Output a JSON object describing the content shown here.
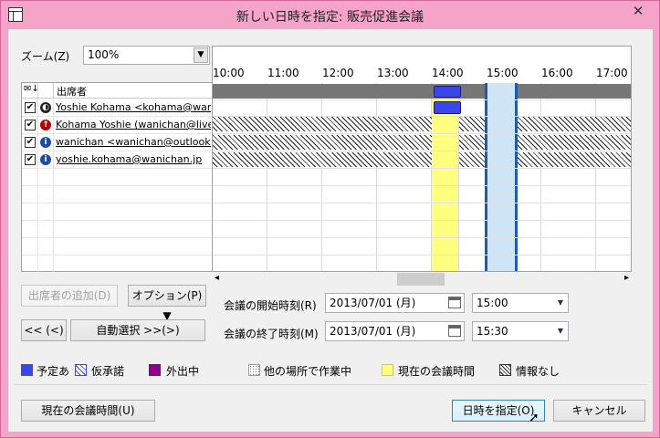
{
  "window": {
    "title": "新しい日時を指定: 販売促進会議",
    "close": "✕"
  },
  "zoom": {
    "label": "ズーム(Z)",
    "value": "100%"
  },
  "attendees": {
    "header": "出席者",
    "rows": [
      {
        "name": "Yoshie Kohama <kohama@wanich",
        "status_color": "#222",
        "status_glyph": "◐"
      },
      {
        "name": "Kohama Yoshie (wanichan@live.jp",
        "status_color": "#b00000",
        "status_glyph": "↑"
      },
      {
        "name": "wanichan <wanichan@outlook.com",
        "status_color": "#1c4ca8",
        "status_glyph": "i"
      },
      {
        "name": "yoshie.kohama@wanichan.jp",
        "status_color": "#1c4ca8",
        "status_glyph": "i"
      }
    ]
  },
  "timeline": {
    "hours": [
      "10:00",
      "11:00",
      "12:00",
      "13:00",
      "14:00",
      "15:00",
      "16:00",
      "17:00"
    ]
  },
  "buttons": {
    "add_attendee": "出席者の追加(D)",
    "options": "オプション(P) ▼",
    "prev": "<< (<)",
    "autopick": "自動選択 >>(>)",
    "current_time": "現在の会議時間(U)",
    "ok": "日時を指定(O)",
    "cancel": "キャンセル"
  },
  "meeting": {
    "start_label": "会議の開始時刻(R)",
    "end_label": "会議の終了時刻(M)",
    "start_date": "2013/07/01 (月)",
    "start_time": "15:00",
    "end_date": "2013/07/01 (月)",
    "end_time": "15:30"
  },
  "legend": {
    "busy": "予定あ",
    "tentative": "仮承諾",
    "out_of_office": "外出中",
    "working_elsewhere": "他の場所で作業中",
    "current_meeting": "現在の会議時間",
    "no_info": "情報なし"
  },
  "colors": {
    "busy": "#3b46e8",
    "out_of_office": "#8e008e",
    "current_meeting": "#ffff80",
    "accent": "#f5a3c9"
  }
}
